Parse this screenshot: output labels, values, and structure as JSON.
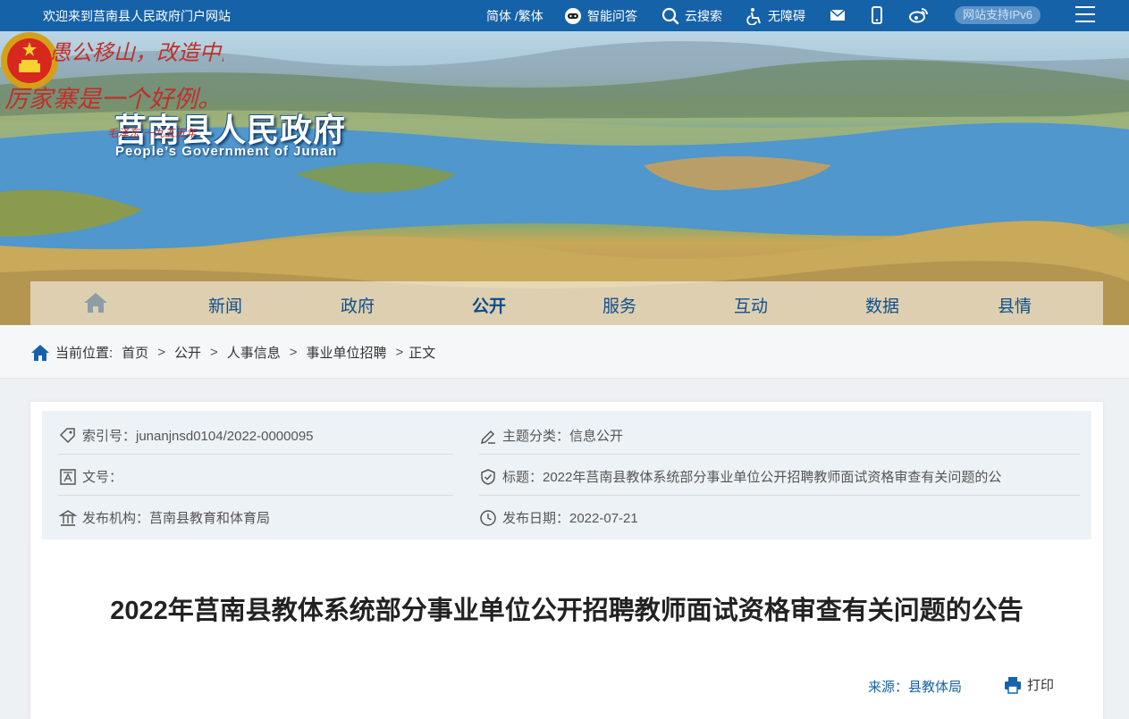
{
  "topbar": {
    "welcome": "欢迎来到莒南县人民政府门户网站",
    "lang": "简体 /繁体",
    "ai_qa": "智能问答",
    "search": "云搜索",
    "accessibility": "无障碍",
    "ipv6": "网站支持IPv6"
  },
  "header": {
    "title": "莒南县人民政府",
    "subtitle": "People’s Government of Junan",
    "calligraphy_line1": "愚公移山，改造中国，",
    "calligraphy_line2": "厉家寨是一个好例。",
    "calligraphy_sign": "毛泽东 一九五五年"
  },
  "nav": {
    "items": [
      "新闻",
      "政府",
      "公开",
      "服务",
      "互动",
      "数据",
      "县情"
    ],
    "active": "公开"
  },
  "breadcrumb": {
    "label": "当前位置:",
    "items": [
      "首页",
      "公开",
      "人事信息",
      "事业单位招聘",
      "正文"
    ]
  },
  "meta": {
    "index_no": "索引号：junanjnsd0104/2022-0000095",
    "category": "主题分类：信息公开",
    "doc_no": "文号：",
    "title": "标题：2022年莒南县教体系统部分事业单位公开招聘教师面试资格审查有关问题的公",
    "publisher": "发布机构：莒南县教育和体育局",
    "publish_date": "发布日期：2022-07-21"
  },
  "article": {
    "title": "2022年莒南县教体系统部分事业单位公开招聘教师面试资格审查有关问题的公告",
    "source": "来源：县教体局",
    "print": "打印"
  },
  "colors": {
    "topbar": "#1662a8",
    "nav_text": "#0f4f8f",
    "meta_bg": "#edf2f6",
    "link": "#1662a8"
  }
}
